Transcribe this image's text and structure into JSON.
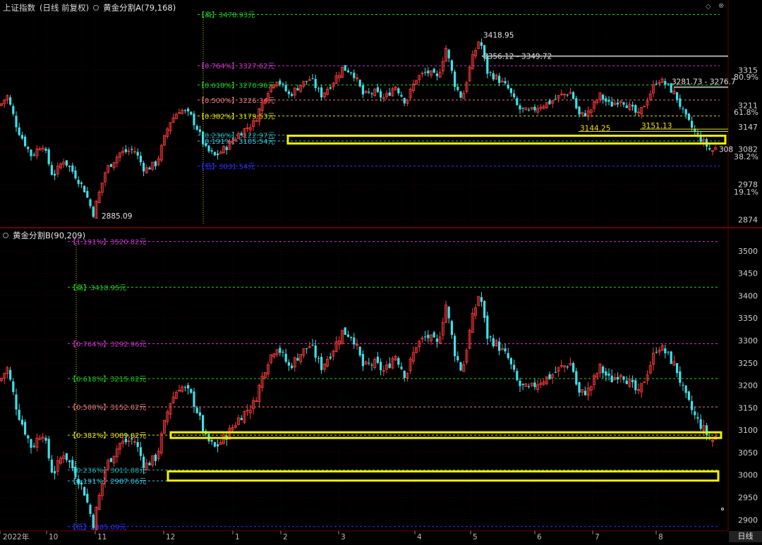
{
  "top": {
    "title": "上证指数",
    "mode": "(日线 前复权)",
    "indicator": "黄金分割A(79,168)",
    "y_labels": [
      "3315",
      "3211",
      "3147",
      "3082",
      "2978",
      "2874"
    ],
    "pct_labels": [
      "80.9%",
      "61.8%",
      "38.2%",
      "19.1%"
    ],
    "ticks": [
      3315,
      3211,
      3147,
      3082,
      2978,
      2874
    ],
    "pct_ticks": [
      {
        "label": "80.9%",
        "value": 3295
      },
      {
        "label": "61.8%",
        "value": 3191
      },
      {
        "label": "38.2%",
        "value": 3060
      },
      {
        "label": "19.1%",
        "value": 2956
      }
    ],
    "fib_levels": [
      {
        "label": "【高】3478.93元",
        "value": 3478.93,
        "color": "#22cc22"
      },
      {
        "label": "【0.764%】3327.62元",
        "value": 3327.62,
        "color": "#cc33cc"
      },
      {
        "label": "【0.618%】3270.96元",
        "value": 3270.96,
        "color": "#22cc22"
      },
      {
        "label": "【0.500%】3226.34元",
        "value": 3226.34,
        "color": "#e07a7a"
      },
      {
        "label": "【0.382%】3179.53元",
        "value": 3179.53,
        "color": "#e0e000"
      },
      {
        "label": "【0.236%】3122.97元",
        "value": 3122.97,
        "color": "#20b0b0"
      },
      {
        "label": "【0.191%】3105.54元",
        "value": 3105.54,
        "color": "#30c8e0"
      },
      {
        "label": "【低】3031.54元",
        "value": 3031.54,
        "color": "#3030ff"
      }
    ],
    "annotations": [
      {
        "text": "3418.95",
        "value": 3418.95
      },
      {
        "text": "3356.12 - 3349.72",
        "value": 3356
      },
      {
        "text": "3281.73 - 3276.7",
        "value": 3281
      },
      {
        "text": "3144.25",
        "value": 3144
      },
      {
        "text": "3151.13",
        "value": 3151
      },
      {
        "text": "2885.09",
        "value": 2885
      },
      {
        "text": "308",
        "value": 3082
      }
    ]
  },
  "bottom": {
    "indicator": "黄金分割B(90,209)",
    "y_labels": [
      "3500",
      "3450",
      "3400",
      "3350",
      "3300",
      "3250",
      "3200",
      "3150",
      "3100",
      "3050",
      "3000",
      "2950",
      "2900"
    ],
    "ticks": [
      3500,
      3450,
      3400,
      3350,
      3300,
      3250,
      3200,
      3150,
      3100,
      3050,
      3000,
      2950,
      2900
    ],
    "fib_levels": [
      {
        "label": "【1.191%】3520.82元",
        "value": 3520.82,
        "color": "#cc33cc"
      },
      {
        "label": "【高】3418.95元",
        "value": 3418.95,
        "color": "#22cc22"
      },
      {
        "label": "【0.764%】3292.96元",
        "value": 3292.96,
        "color": "#cc33cc"
      },
      {
        "label": "【0.618%】3215.02元",
        "value": 3215.02,
        "color": "#22cc22"
      },
      {
        "label": "【0.500%】3152.02元",
        "value": 3152.02,
        "color": "#e07a7a"
      },
      {
        "label": "【0.382%】3089.02元",
        "value": 3089.02,
        "color": "#e0e000"
      },
      {
        "label": "【0.236%】3011.08元",
        "value": 3011.08,
        "color": "#20b0b0"
      },
      {
        "label": "【0.191%】2987.06元",
        "value": 2987.06,
        "color": "#30c8e0"
      },
      {
        "label": "【低】2885.09元",
        "value": 2885.09,
        "color": "#3030ff"
      }
    ]
  },
  "time_axis": {
    "labels": [
      "2022年",
      "10",
      "11",
      "12",
      "1",
      "2",
      "3",
      "4",
      "5",
      "6",
      "7",
      "8"
    ],
    "period": "日线"
  },
  "chart_data": {
    "type": "candlestick",
    "symbol": "上证指数",
    "period": "日线",
    "high": 3418.95,
    "low": 2885.09,
    "top_levels": [
      3478.93,
      3327.62,
      3270.96,
      3226.34,
      3179.53,
      3122.97,
      3105.54,
      3031.54
    ],
    "bottom_levels": [
      3520.82,
      3418.95,
      3292.96,
      3215.02,
      3152.02,
      3089.02,
      3011.08,
      2987.06,
      2885.09
    ]
  },
  "colors": {
    "up": "#ff3b3b",
    "down": "#3ee0e8",
    "box": "#f0f000",
    "bg": "#000000"
  }
}
